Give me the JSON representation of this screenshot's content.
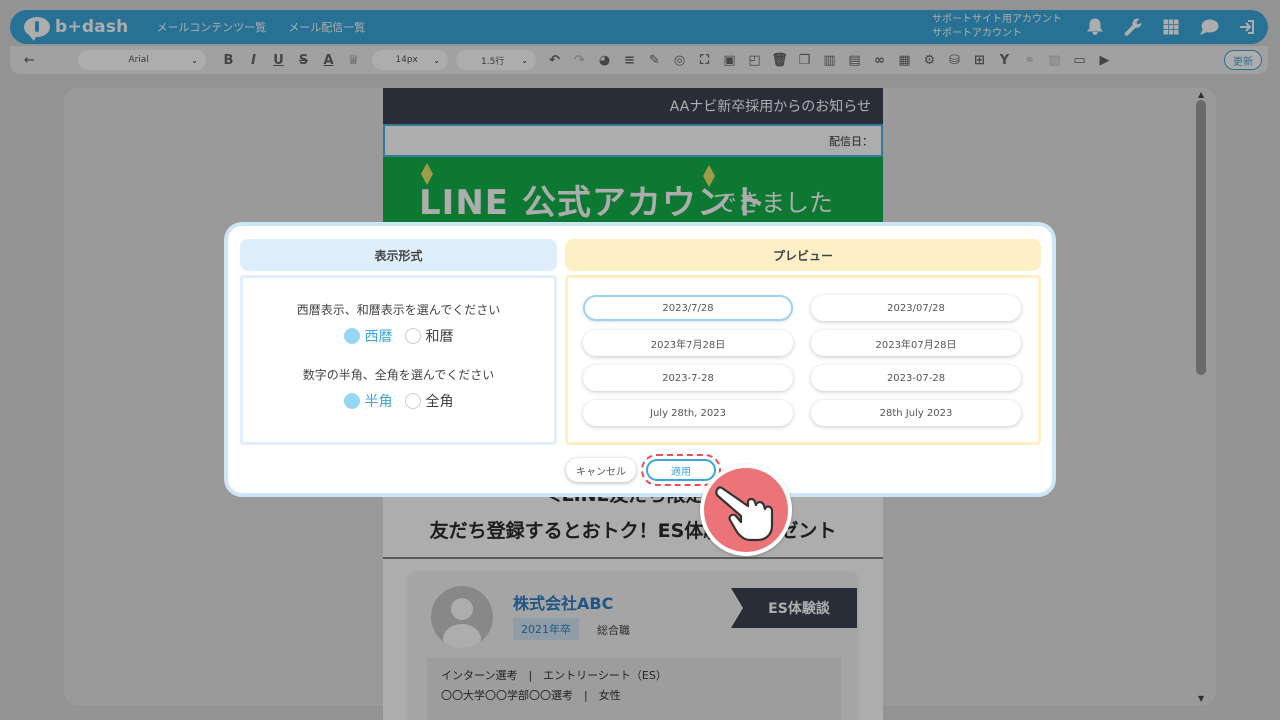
{
  "header": {
    "logo_text": "b+dash",
    "nav": [
      "メールコンテンツ一覧",
      "メール配信一覧"
    ],
    "account_line1": "サポートサイト用アカウント",
    "account_line2": "サポートアカウント"
  },
  "toolbar": {
    "font_value": "Arial",
    "size_value": "14px",
    "line_value": "1.5行",
    "update_label": "更新"
  },
  "mail": {
    "header_title": "AAナビ新卒採用からのお知らせ",
    "date_label": "配信日：",
    "banner_main": "LINE 公式アカウント",
    "banner_sub": "できました",
    "subtitle1": "＜LINE友だち限定＞",
    "subtitle2": "友だち登録するとおトク！ES体験談プレゼント",
    "card": {
      "company": "株式会社ABC",
      "year": "2021年卒",
      "type": "総合職",
      "tag": "ES体験談",
      "info1": "インターン選考　|　エントリーシート（ES）",
      "info2": "〇〇大学〇〇学部〇〇選考　|　女性"
    }
  },
  "modal": {
    "left_title": "表示形式",
    "right_title": "プレビュー",
    "q1": "西暦表示、和暦表示を選んでください",
    "q1_options": [
      "西暦",
      "和暦"
    ],
    "q1_selected": "西暦",
    "q2": "数字の半角、全角を選んでください",
    "q2_options": [
      "半角",
      "全角"
    ],
    "q2_selected": "半角",
    "formats": [
      "2023/7/28",
      "2023/07/28",
      "2023年7月28日",
      "2023年07月28日",
      "2023-7-28",
      "2023-07-28",
      "July 28th, 2023",
      "28th July 2023"
    ],
    "selected_format": "2023/7/28",
    "cancel_label": "キャンセル",
    "apply_label": "適用"
  },
  "colors": {
    "brand": "#3aa7dc",
    "highlight": "#e84f5a",
    "pointer": "#ec7479"
  }
}
